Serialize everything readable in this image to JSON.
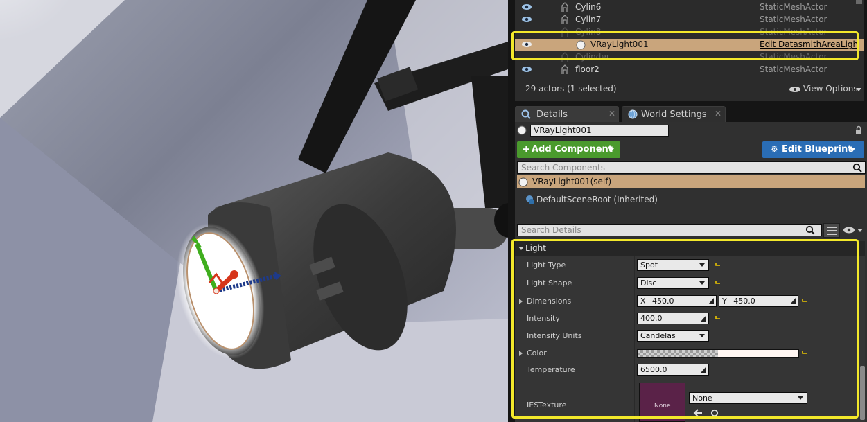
{
  "outliner": {
    "rows": [
      {
        "name": "Cylin6",
        "type": "StaticMeshActor"
      },
      {
        "name": "Cylin7",
        "type": "StaticMeshActor"
      },
      {
        "name": "Cylin8",
        "type": "StaticMeshActor"
      },
      {
        "name": "VRayLight001",
        "type": "Edit DatasmithAreaLigh"
      },
      {
        "name": "Cylinder",
        "type": "StaticMeshActor"
      },
      {
        "name": "floor2",
        "type": "StaticMeshActor"
      }
    ],
    "actor_count": "29 actors (1 selected)",
    "view_options": "View Options"
  },
  "tabs": [
    {
      "label": "Details"
    },
    {
      "label": "World Settings"
    }
  ],
  "details": {
    "actor_name": "VRayLight001",
    "add_component": "Add Component",
    "edit_blueprint": "Edit Blueprint",
    "search_components_placeholder": "Search Components",
    "components": [
      {
        "label": "VRayLight001(self)"
      },
      {
        "label": "DefaultSceneRoot (Inherited)"
      }
    ],
    "search_details_placeholder": "Search Details"
  },
  "light": {
    "section": "Light",
    "light_type": {
      "label": "Light Type",
      "value": "Spot"
    },
    "light_shape": {
      "label": "Light Shape",
      "value": "Disc"
    },
    "dimensions": {
      "label": "Dimensions",
      "x_label": "X",
      "x": "450.0",
      "y_label": "Y",
      "y": "450.0"
    },
    "intensity": {
      "label": "Intensity",
      "value": "400.0"
    },
    "intensity_units": {
      "label": "Intensity Units",
      "value": "Candelas"
    },
    "color": {
      "label": "Color"
    },
    "temperature": {
      "label": "Temperature",
      "value": "6500.0"
    },
    "ies_texture": {
      "label": "IESTexture",
      "thumb": "None",
      "value": "None"
    }
  },
  "colors": {
    "accent_highlight": "#f3e82b",
    "selected_row": "#c9a57c",
    "add_component": "#4a9a2d",
    "edit_blueprint": "#2a6db5"
  }
}
